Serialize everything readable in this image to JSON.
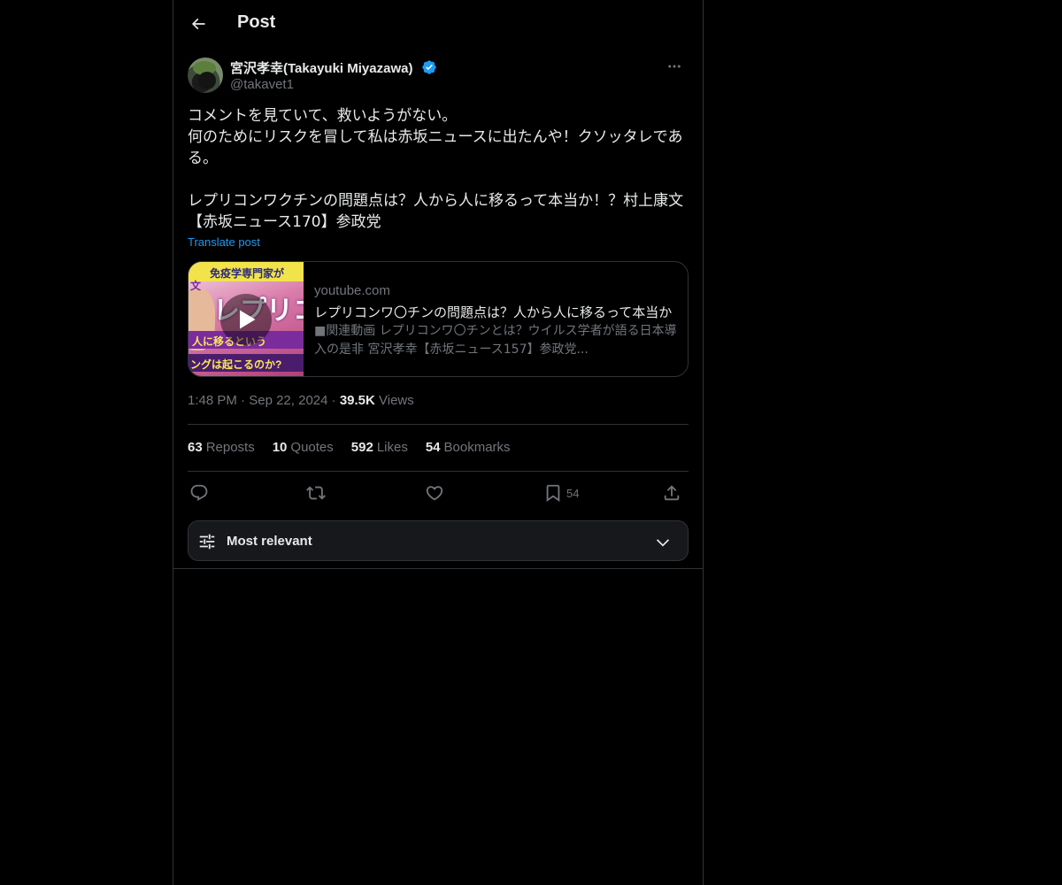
{
  "header": {
    "title": "Post"
  },
  "author": {
    "display_name": "宮沢孝幸(Takayuki Miyazawa)",
    "handle": "@takavet1",
    "verified": true
  },
  "post": {
    "text": "コメントを見ていて、救いようがない。\n何のためにリスクを冒して私は赤坂ニュースに出たんや！クソッタレであ\nる。\n\nレプリコンワクチンの問題点は？人から人に移るって本当か！？村上康文\n【赤坂ニュース170】参政党",
    "translate_label": "Translate post"
  },
  "card": {
    "domain": "youtube.com",
    "title": "レプリコンワ〇チンの問題点は？人から人に移るって本当か",
    "description": "■関連動画 レプリコンワ〇チンとは？ウイルス学者が語る日本導入の是非 宮沢孝幸【赤坂ニュース157】参政党...",
    "thumb_texts": [
      "免疫学専門家が",
      "レプリコ",
      "文",
      "人に移るという",
      "ングは起こるのか?"
    ]
  },
  "meta": {
    "time": "1:48 PM",
    "date": "Sep 22, 2024",
    "views_count": "39.5K",
    "views_label": "Views",
    "separator": "·"
  },
  "stats": {
    "reposts_count": "63",
    "reposts_label": "Reposts",
    "quotes_count": "10",
    "quotes_label": "Quotes",
    "likes_count": "592",
    "likes_label": "Likes",
    "bookmarks_count": "54",
    "bookmarks_label": "Bookmarks"
  },
  "actions": {
    "bookmark_count": "54"
  },
  "sort": {
    "label": "Most relevant"
  },
  "colors": {
    "background": "#000000",
    "text": "#e7e9ea",
    "secondary": "#71767b",
    "accent": "#1d9bf0",
    "border": "#2f3336"
  },
  "icons": [
    "back-arrow-icon",
    "verified-badge-icon",
    "more-icon",
    "play-icon",
    "reply-icon",
    "repost-icon",
    "like-icon",
    "bookmark-icon",
    "share-icon",
    "filter-icon",
    "chevron-down-icon"
  ]
}
